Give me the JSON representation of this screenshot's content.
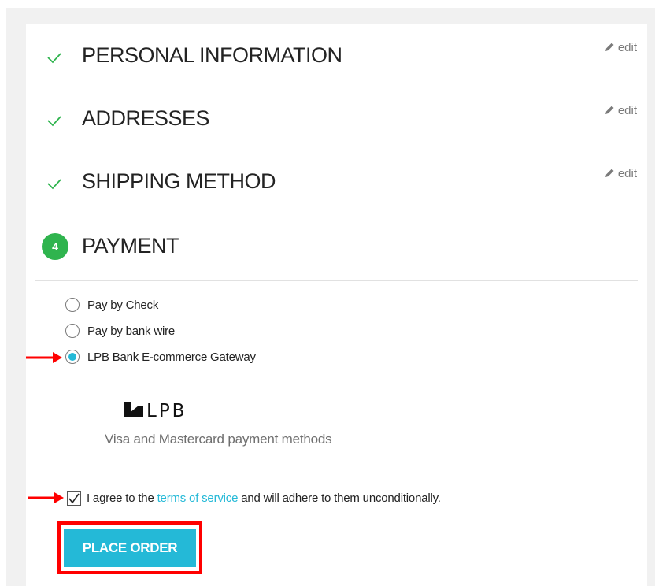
{
  "steps": [
    {
      "title": "PERSONAL INFORMATION",
      "edit_label": "edit",
      "status": "complete"
    },
    {
      "title": "ADDRESSES",
      "edit_label": "edit",
      "status": "complete"
    },
    {
      "title": "SHIPPING METHOD",
      "edit_label": "edit",
      "status": "complete"
    }
  ],
  "payment": {
    "step_number": "4",
    "title": "PAYMENT",
    "options": [
      {
        "label": "Pay by Check",
        "selected": false
      },
      {
        "label": "Pay by bank wire",
        "selected": false
      },
      {
        "label": "LPB Bank E-commerce Gateway",
        "selected": true
      }
    ],
    "logo_text": "LPB",
    "methods_text": "Visa and Mastercard payment methods",
    "terms": {
      "prefix": "I agree to the",
      "link": "terms of service",
      "suffix": "and will adhere to them unconditionally.",
      "checked": true
    },
    "place_order_label": "PLACE ORDER"
  },
  "colors": {
    "accent": "#24b9d7",
    "check_green": "#2fb44e",
    "annotation_red": "#ff0000"
  },
  "icons": {
    "check": "check-icon",
    "edit": "pencil-icon",
    "arrow": "arrow-right-icon"
  }
}
